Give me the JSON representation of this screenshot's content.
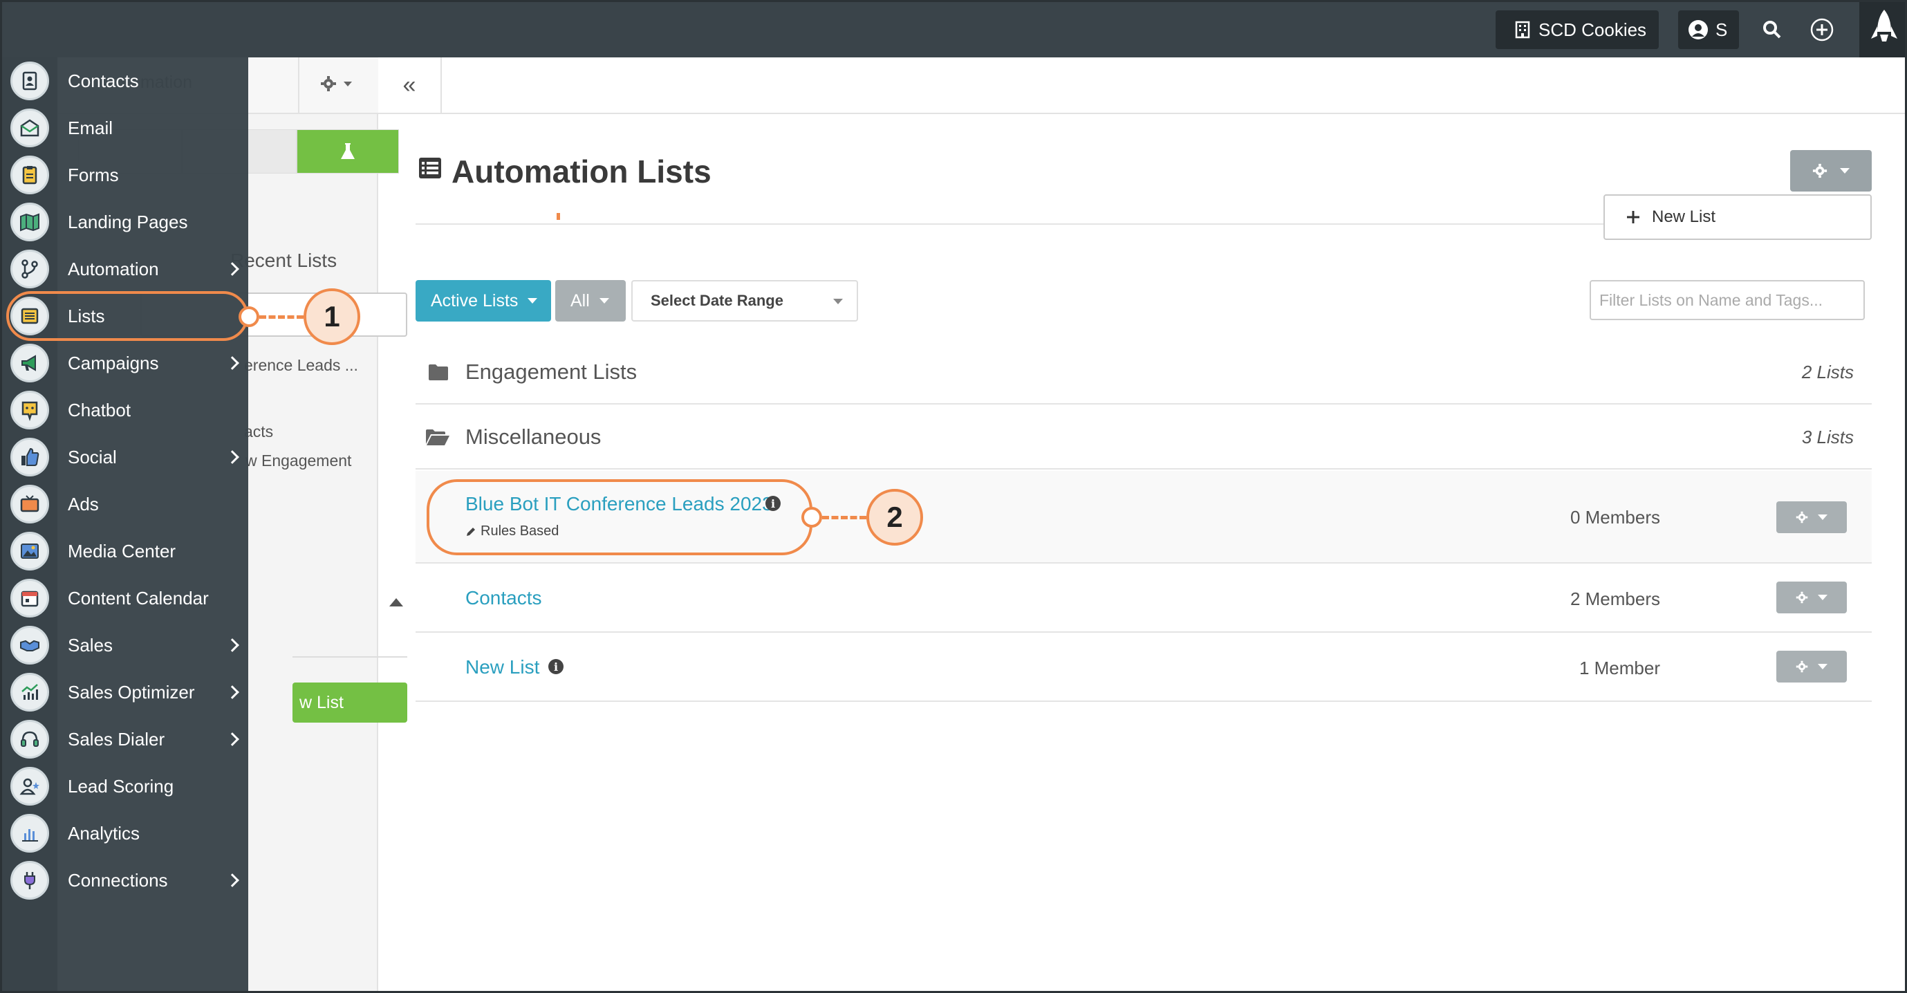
{
  "topbar": {
    "company": "SCD Cookies",
    "user_initial": "S",
    "icons": [
      "building-icon",
      "user-icon",
      "search-icon",
      "plus-icon",
      "rocket-icon"
    ]
  },
  "nav": {
    "items": [
      {
        "label": "Contacts",
        "icon": "contacts-icon",
        "chevron": false
      },
      {
        "label": "Email",
        "icon": "email-icon",
        "chevron": false
      },
      {
        "label": "Forms",
        "icon": "forms-icon",
        "chevron": false
      },
      {
        "label": "Landing Pages",
        "icon": "map-icon",
        "chevron": false
      },
      {
        "label": "Automation",
        "icon": "automation-icon",
        "chevron": true
      },
      {
        "label": "Lists",
        "icon": "lists-icon",
        "chevron": false
      },
      {
        "label": "Campaigns",
        "icon": "megaphone-icon",
        "chevron": true
      },
      {
        "label": "Chatbot",
        "icon": "chatbot-icon",
        "chevron": false
      },
      {
        "label": "Social",
        "icon": "thumbs-up-icon",
        "chevron": true
      },
      {
        "label": "Ads",
        "icon": "tv-icon",
        "chevron": false
      },
      {
        "label": "Media Center",
        "icon": "media-icon",
        "chevron": false
      },
      {
        "label": "Content Calendar",
        "icon": "calendar-icon",
        "chevron": false
      },
      {
        "label": "Sales",
        "icon": "handshake-icon",
        "chevron": true
      },
      {
        "label": "Sales Optimizer",
        "icon": "trend-chart-icon",
        "chevron": true
      },
      {
        "label": "Sales Dialer",
        "icon": "headset-icon",
        "chevron": true
      },
      {
        "label": "Lead Scoring",
        "icon": "user-star-icon",
        "chevron": false
      },
      {
        "label": "Analytics",
        "icon": "bar-chart-icon",
        "chevron": false
      },
      {
        "label": "Connections",
        "icon": "plug-icon",
        "chevron": true
      }
    ]
  },
  "subpanel": {
    "header_fragment": "mation",
    "title_fragment": "Recent Lists",
    "items": [
      "erence Leads ...",
      "acts",
      "w Engagement"
    ],
    "button_fragment": "w List"
  },
  "main": {
    "title": "Automation Lists",
    "new_list_label": "New List",
    "filters": {
      "active_label": "Active Lists",
      "all_label": "All",
      "date_label": "Select Date Range",
      "search_placeholder": "Filter Lists on Name and Tags..."
    },
    "folders": [
      {
        "name": "Engagement Lists",
        "count": "2 Lists",
        "icon": "folder-icon"
      },
      {
        "name": "Miscellaneous",
        "count": "3 Lists",
        "icon": "folder-open-icon"
      }
    ],
    "lists": [
      {
        "name": "Blue Bot IT Conference Leads 2023",
        "type": "Rules Based",
        "members": "0 Members",
        "info": true
      },
      {
        "name": "Contacts",
        "type": "",
        "members": "2 Members",
        "info": false
      },
      {
        "name": "New List",
        "type": "",
        "members": "1 Member",
        "info": true
      }
    ]
  },
  "callouts": [
    "1",
    "2"
  ],
  "colors": {
    "accent_teal": "#39a9c4",
    "callout_orange": "#f08a4b",
    "nav_bg": "#3a444a",
    "green": "#74c044"
  }
}
